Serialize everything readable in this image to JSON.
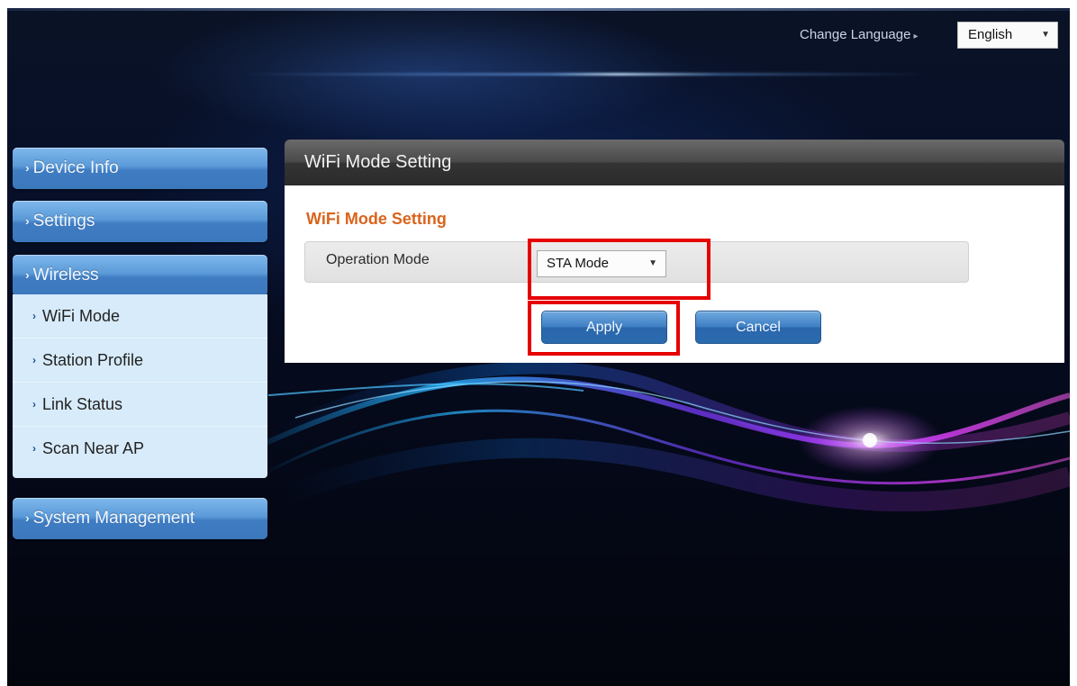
{
  "header": {
    "change_language_label": "Change Language",
    "language_selected": "English"
  },
  "sidebar": {
    "device_info": "Device Info",
    "settings": "Settings",
    "wireless": "Wireless",
    "wireless_items": [
      "WiFi Mode",
      "Station Profile",
      "Link Status",
      "Scan Near AP"
    ],
    "system_management": "System Management"
  },
  "main": {
    "panel_title": "WiFi Mode Setting",
    "section_title": "WiFi Mode Setting",
    "operation_mode_label": "Operation Mode",
    "operation_mode_value": "STA Mode",
    "apply_label": "Apply",
    "cancel_label": "Cancel"
  },
  "colors": {
    "section_title": "#d9641b",
    "highlight_box": "#e60000",
    "nav_button": "#4a88cc"
  }
}
